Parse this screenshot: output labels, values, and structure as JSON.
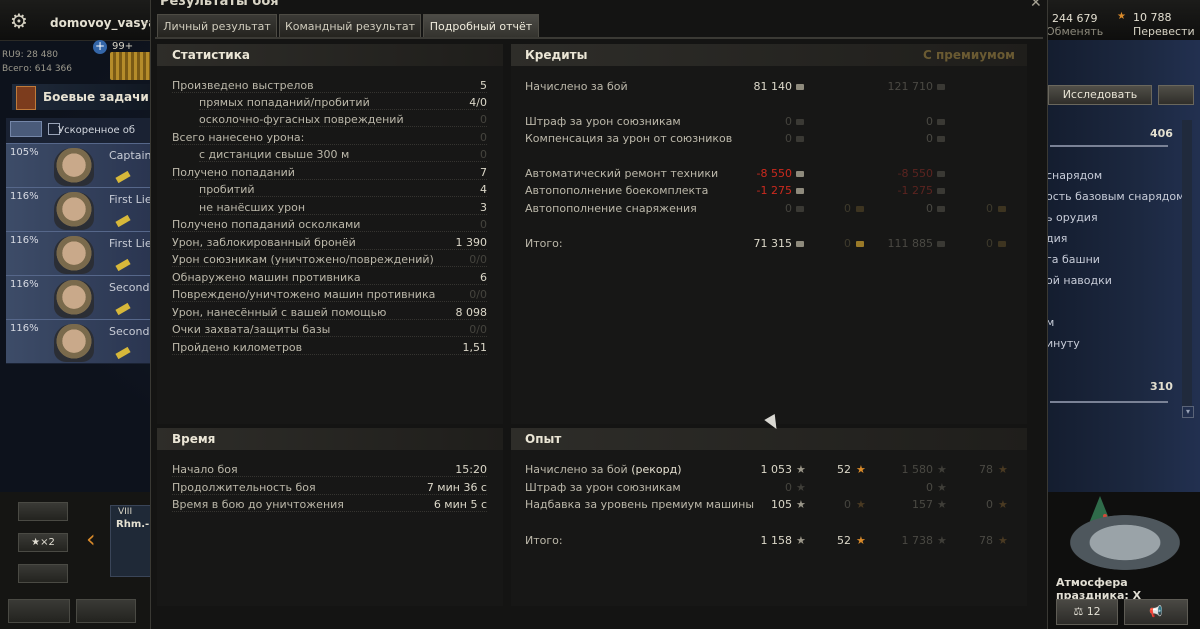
{
  "topbar": {
    "username": "domovoy_vasya",
    "ru_rating": "RU9: 28 480",
    "total": "Всего: 614 366",
    "notifications": "99+",
    "tasks_label": "Боевые задачи",
    "crew_header": "Ускоренное об",
    "free_xp": "244 679",
    "exchange_label": "Обменять",
    "gold": "10 788",
    "transfer_label": "Перевести",
    "transfer_badge": "%"
  },
  "crew": [
    {
      "pct": "105%",
      "rank": "Captain"
    },
    {
      "pct": "116%",
      "rank": "First Lie"
    },
    {
      "pct": "116%",
      "rank": "First Lie"
    },
    {
      "pct": "116%",
      "rank": "Second"
    },
    {
      "pct": "116%",
      "rank": "Second"
    }
  ],
  "left_bottom": {
    "x2_label": "×2",
    "tier": "VIII",
    "tank_name": "Rhm.-B"
  },
  "right_panel": {
    "research_label": "Исследовать",
    "value_top": "406",
    "value_bottom": "310",
    "items": [
      "снарядом",
      "ость базовым снарядом",
      "ь орудия",
      "дия",
      "га башни",
      "ой наводки",
      "м",
      "инуту"
    ],
    "festive_label": "Атмосфера праздника: X",
    "bottom_count": "12"
  },
  "dialog": {
    "title": "Результаты боя",
    "tabs": [
      "Личный результат",
      "Командный результат",
      "Подробный отчёт"
    ],
    "active_tab": "Подробный отчёт"
  },
  "stats": {
    "title": "Статистика",
    "rows": [
      {
        "label": "Произведено выстрелов",
        "value": "5",
        "indent": false,
        "dim": false
      },
      {
        "label": "прямых попаданий/пробитий",
        "value": "4/0",
        "indent": true,
        "dim": false
      },
      {
        "label": "осколочно-фугасных повреждений",
        "value": "0",
        "indent": true,
        "dim": true
      },
      {
        "label": "Всего нанесено урона:",
        "value": "0",
        "indent": false,
        "dim": true
      },
      {
        "label": "с дистанции свыше 300 м",
        "value": "0",
        "indent": true,
        "dim": true
      },
      {
        "label": "Получено попаданий",
        "value": "7",
        "indent": false,
        "dim": false
      },
      {
        "label": "пробитий",
        "value": "4",
        "indent": true,
        "dim": false
      },
      {
        "label": "не нанёсших урон",
        "value": "3",
        "indent": true,
        "dim": false
      },
      {
        "label": "Получено попаданий осколками",
        "value": "0",
        "indent": false,
        "dim": true
      },
      {
        "label": "Урон, заблокированный бронёй",
        "value": "1 390",
        "indent": false,
        "dim": false
      },
      {
        "label": "Урон союзникам (уничтожено/повреждений)",
        "value": "0/0",
        "indent": false,
        "dim": true
      },
      {
        "label": "Обнаружено машин противника",
        "value": "6",
        "indent": false,
        "dim": false
      },
      {
        "label": "Повреждено/уничтожено машин противника",
        "value": "0/0",
        "indent": false,
        "dim": true
      },
      {
        "label": "Урон, нанесённый с вашей помощью",
        "value": "8 098",
        "indent": false,
        "dim": false
      },
      {
        "label": "Очки захвата/защиты базы",
        "value": "0/0",
        "indent": false,
        "dim": true
      },
      {
        "label": "Пройдено километров",
        "value": "1,51",
        "indent": false,
        "dim": false
      }
    ]
  },
  "credits": {
    "title": "Кредиты",
    "premium_title": "С премиумом",
    "rows": [
      {
        "label": "Начислено за бой",
        "value": "81 140",
        "prem": "121 710",
        "type": "normal"
      },
      {
        "label": "Штраф за урон союзникам",
        "value": "0",
        "prem": "0",
        "type": "zero"
      },
      {
        "label": "Компенсация за урон от союзников",
        "value": "0",
        "prem": "0",
        "type": "zero"
      },
      {
        "label": "Автоматический ремонт техники",
        "value": "-8 550",
        "prem": "-8 550",
        "type": "red"
      },
      {
        "label": "Автопополнение боекомплекта",
        "value": "-1 275",
        "prem": "-1 275",
        "type": "red"
      },
      {
        "label": "Автопополнение снаряжения",
        "value": "0",
        "gold": "0",
        "prem": "0",
        "prem_gold": "0",
        "type": "zero-gold"
      },
      {
        "label": "Итого:",
        "value": "71 315",
        "gold": "0",
        "prem": "111 885",
        "prem_gold": "0",
        "type": "total"
      }
    ]
  },
  "time": {
    "title": "Время",
    "rows": [
      {
        "label": "Начало боя",
        "value": "15:20"
      },
      {
        "label": "Продолжительность боя",
        "value": "7 мин 36 с"
      },
      {
        "label": "Время в бою до уничтожения",
        "value": "6 мин 5 с"
      }
    ]
  },
  "xp": {
    "title": "Опыт",
    "rows": [
      {
        "label": "Начислено за бой",
        "label_suffix": "(рекорд)",
        "xp": "1 053",
        "free": "52",
        "prem_xp": "1 580",
        "prem_free": "78"
      },
      {
        "label": "Штраф за урон союзникам",
        "xp": "0",
        "free": "",
        "prem_xp": "0",
        "prem_free": ""
      },
      {
        "label": "Надбавка за уровень премиум машины",
        "xp": "105",
        "free": "0",
        "prem_xp": "157",
        "prem_free": "0"
      },
      {
        "label": "Итого:",
        "xp": "1 158",
        "free": "52",
        "prem_xp": "1 738",
        "prem_free": "78"
      }
    ]
  }
}
